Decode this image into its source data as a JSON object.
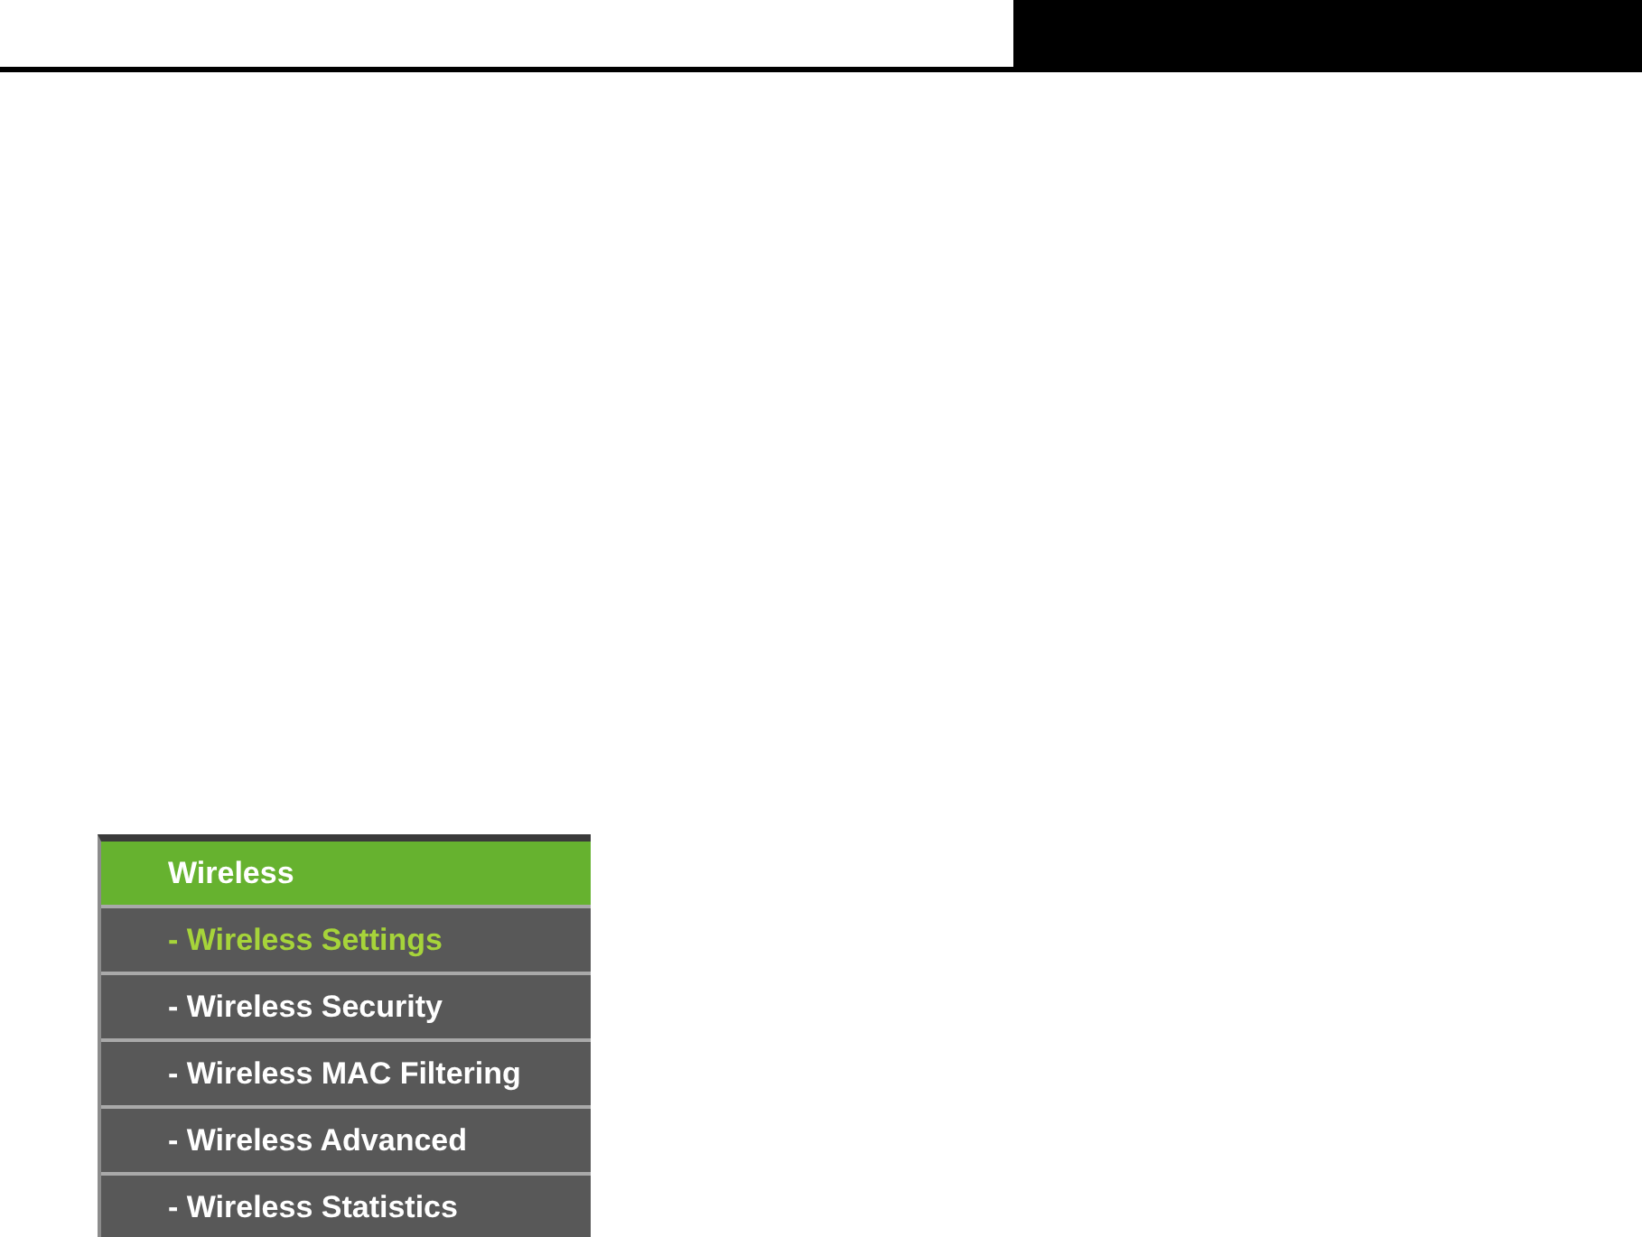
{
  "menu": {
    "title": "Wireless",
    "items": [
      {
        "label": "- Wireless Settings",
        "selected": true
      },
      {
        "label": "- Wireless Security",
        "selected": false
      },
      {
        "label": "- Wireless MAC Filtering",
        "selected": false
      },
      {
        "label": "- Wireless Advanced",
        "selected": false
      },
      {
        "label": "- Wireless Statistics",
        "selected": false
      }
    ]
  }
}
